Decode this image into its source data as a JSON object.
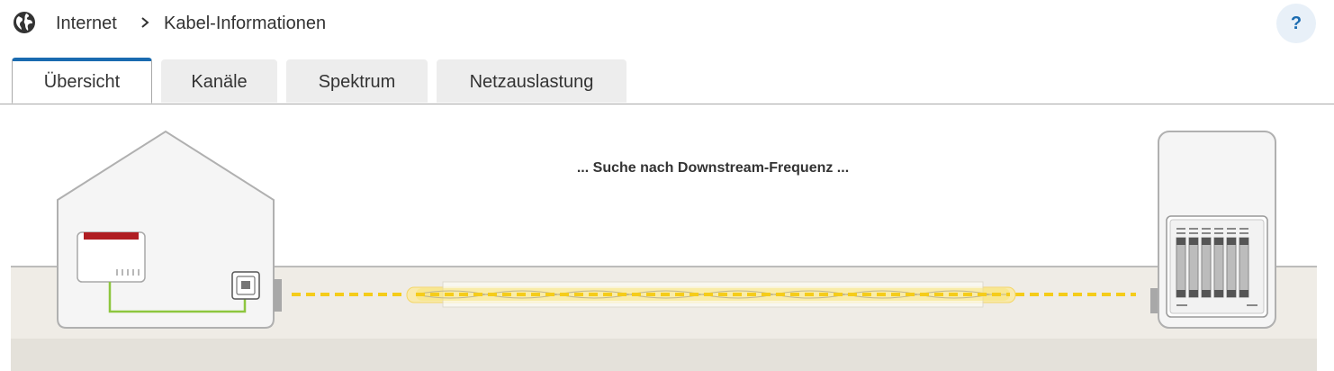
{
  "breadcrumb": {
    "section": "Internet",
    "separator": "›",
    "current": "Kabel-Informationen"
  },
  "help": {
    "label": "?"
  },
  "tabs": [
    {
      "label": "Übersicht",
      "active": true
    },
    {
      "label": "Kanäle",
      "active": false
    },
    {
      "label": "Spektrum",
      "active": false
    },
    {
      "label": "Netzauslastung",
      "active": false
    }
  ],
  "status": {
    "message": "... Suche nach Downstream-Frequenz ..."
  },
  "colors": {
    "accent": "#1a6bb0",
    "cable": "#f5cc1a",
    "router_stripe": "#b01e23",
    "lan_cable": "#8dc63f",
    "ground": "#efece6",
    "ground_dark": "#e4e1da"
  },
  "icons": {
    "globe": "globe-icon",
    "chevron": "chevron-right-icon",
    "house": "house-icon",
    "router": "router-icon",
    "wall_socket": "cable-socket-icon",
    "cabinet": "distribution-cabinet-icon"
  }
}
